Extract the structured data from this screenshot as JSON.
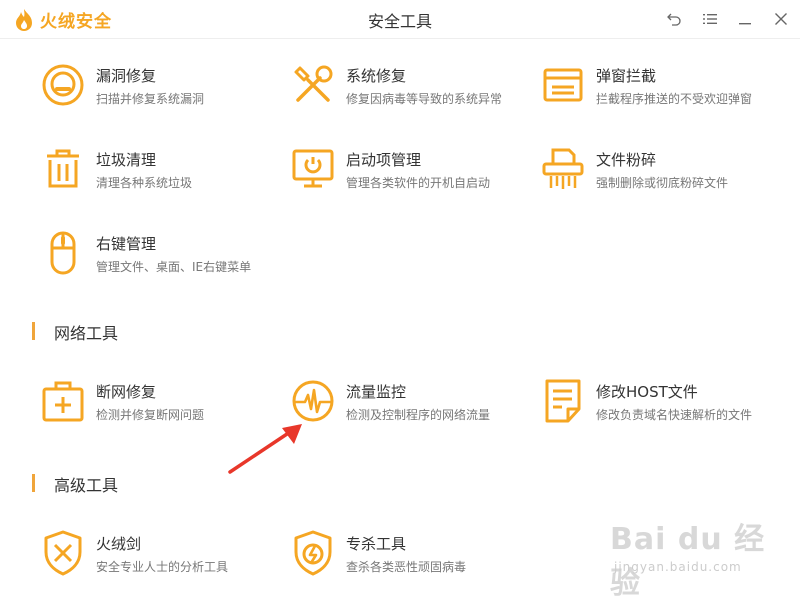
{
  "app": {
    "logo_text": "火绒安全",
    "window_title": "安全工具"
  },
  "colors": {
    "accent": "#f5a623",
    "icon": "#f5a623",
    "arrow": "#e8372a"
  },
  "tools_system": [
    {
      "name": "漏洞修复",
      "desc": "扫描并修复系统漏洞",
      "icon": "vulnerability-fix-icon"
    },
    {
      "name": "系统修复",
      "desc": "修复因病毒等导致的系统异常",
      "icon": "wrench-screwdriver-icon"
    },
    {
      "name": "弹窗拦截",
      "desc": "拦截程序推送的不受欢迎弹窗",
      "icon": "popup-window-icon"
    },
    {
      "name": "垃圾清理",
      "desc": "清理各种系统垃圾",
      "icon": "trash-can-icon"
    },
    {
      "name": "启动项管理",
      "desc": "管理各类软件的开机自启动",
      "icon": "monitor-power-icon"
    },
    {
      "name": "文件粉碎",
      "desc": "强制删除或彻底粉碎文件",
      "icon": "shredder-icon"
    },
    {
      "name": "右键管理",
      "desc": "管理文件、桌面、IE右键菜单",
      "icon": "mouse-icon"
    }
  ],
  "section_network": "网络工具",
  "tools_network": [
    {
      "name": "断网修复",
      "desc": "检测并修复断网问题",
      "icon": "first-aid-kit-icon"
    },
    {
      "name": "流量监控",
      "desc": "检测及控制程序的网络流量",
      "icon": "heartbeat-monitor-icon"
    },
    {
      "name": "修改HOST文件",
      "desc": "修改负责域名快速解析的文件",
      "icon": "document-icon"
    }
  ],
  "section_advanced": "高级工具",
  "tools_advanced": [
    {
      "name": "火绒剑",
      "desc": "安全专业人士的分析工具",
      "icon": "shield-sword-icon"
    },
    {
      "name": "专杀工具",
      "desc": "查杀各类恶性顽固病毒",
      "icon": "shield-lightning-icon"
    }
  ],
  "watermark": {
    "main": "Bai du 经验",
    "sub": "jingyan.baidu.com"
  }
}
